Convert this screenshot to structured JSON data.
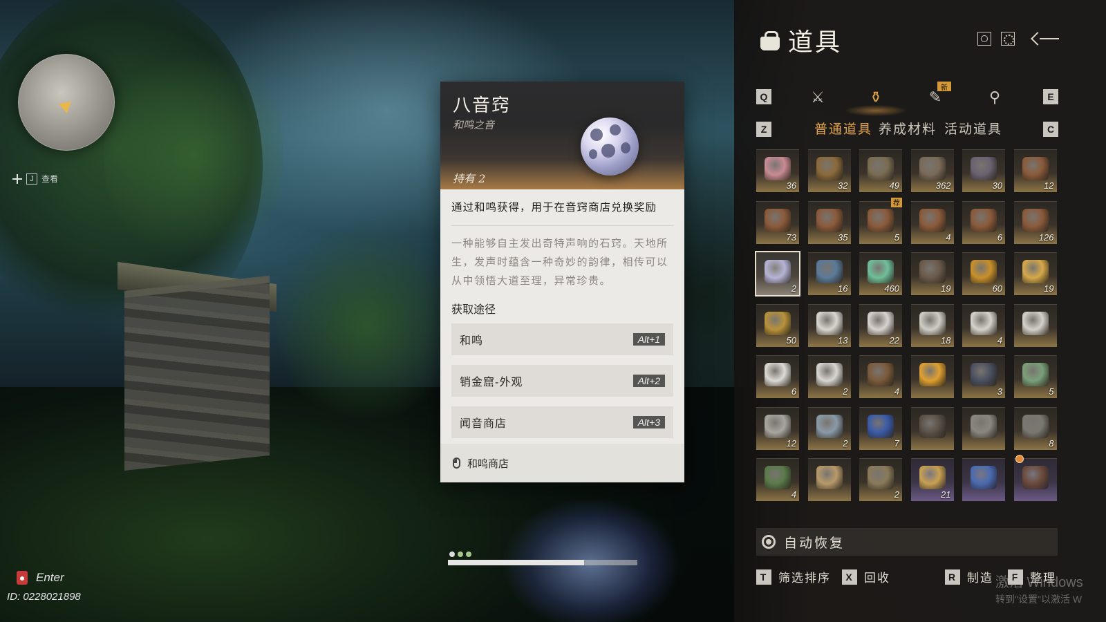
{
  "hud": {
    "map_hint_key": "J",
    "map_hint_label": "查看",
    "enter_label": "Enter",
    "uid": "ID: 0228021898"
  },
  "tooltip": {
    "title": "八音窍",
    "subtitle": "和鸣之音",
    "owned": "持有 2",
    "summary": "通过和鸣获得，用于在音窍商店兑换奖励",
    "description": "一种能够自主发出奇特声响的石窍。天地所生，发声时蕴含一种奇妙的韵律，相传可以从中领悟大道至理，异常珍贵。",
    "source_header": "获取途径",
    "sources": [
      {
        "label": "和鸣",
        "key": "Alt+1"
      },
      {
        "label": "销金窟-外观",
        "key": "Alt+2"
      },
      {
        "label": "闻音商店",
        "key": "Alt+3"
      }
    ],
    "footer_label": "和鸣商店"
  },
  "pager": {
    "page_count": 3,
    "active_page": 3,
    "progress": 0.72
  },
  "panel": {
    "title": "道具",
    "category_left_key": "Q",
    "category_right_key": "E",
    "categories": [
      {
        "icon": "weapon-icon",
        "glyph": "⚔",
        "badge": ""
      },
      {
        "icon": "pouch-icon",
        "glyph": "⚱",
        "badge": "",
        "active": true
      },
      {
        "icon": "tool-icon",
        "glyph": "✎",
        "badge": "新"
      },
      {
        "icon": "location-icon",
        "glyph": "⚲",
        "badge": ""
      }
    ],
    "subtab_left_key": "Z",
    "subtab_right_key": "C",
    "subtabs": [
      {
        "label": "普通道具",
        "active": true
      },
      {
        "label": "养成材料",
        "active": false
      },
      {
        "label": "活动道具",
        "active": false
      }
    ],
    "items": [
      {
        "qty": "36",
        "color": "#c98b94"
      },
      {
        "qty": "32",
        "color": "#8a6a3a"
      },
      {
        "qty": "49",
        "color": "#7a6c52"
      },
      {
        "qty": "362",
        "color": "#7a6a58"
      },
      {
        "qty": "30",
        "color": "#6a6270"
      },
      {
        "qty": "12",
        "color": "#8a5a3a"
      },
      {
        "qty": "73",
        "color": "#8a5a3a"
      },
      {
        "qty": "35",
        "color": "#8a5a3a"
      },
      {
        "qty": "5",
        "color": "#8a5a3a",
        "tag": "荐"
      },
      {
        "qty": "4",
        "color": "#8a5a3a"
      },
      {
        "qty": "6",
        "color": "#8a5a3a"
      },
      {
        "qty": "126",
        "color": "#8a5a3a"
      },
      {
        "qty": "2",
        "color": "#b6b4d6",
        "selected": true
      },
      {
        "qty": "16",
        "color": "#5a7a9a"
      },
      {
        "qty": "460",
        "color": "#6fbf9a"
      },
      {
        "qty": "19",
        "color": "#6a5a4a"
      },
      {
        "qty": "60",
        "color": "#c9902a"
      },
      {
        "qty": "19",
        "color": "#d6a94a"
      },
      {
        "qty": "50",
        "color": "#b8923a"
      },
      {
        "qty": "13",
        "color": "#d8d6d0"
      },
      {
        "qty": "22",
        "color": "#d8d2d0"
      },
      {
        "qty": "18",
        "color": "#d0ccc6"
      },
      {
        "qty": "4",
        "color": "#d6d2cc"
      },
      {
        "qty": "",
        "color": "#d4d0ca"
      },
      {
        "qty": "6",
        "color": "#dcdad4"
      },
      {
        "qty": "2",
        "color": "#d8d6d0"
      },
      {
        "qty": "4",
        "color": "#7a5a3a"
      },
      {
        "qty": "",
        "color": "#e0a030"
      },
      {
        "qty": "3",
        "color": "#4a5060"
      },
      {
        "qty": "5",
        "color": "#7aa07a"
      },
      {
        "qty": "12",
        "color": "#a8a6a0"
      },
      {
        "qty": "2",
        "color": "#8a9aa8"
      },
      {
        "qty": "7",
        "color": "#3a5aa8"
      },
      {
        "qty": "",
        "color": "#5a5048"
      },
      {
        "qty": "",
        "color": "#8a8680"
      },
      {
        "qty": "8",
        "color": "#7a7670"
      },
      {
        "qty": "4",
        "color": "#5a7a4a"
      },
      {
        "qty": "",
        "color": "#b89a6a"
      },
      {
        "qty": "2",
        "color": "#8a7a5a"
      },
      {
        "qty": "21",
        "color": "#c8a050",
        "purple": true
      },
      {
        "qty": "",
        "color": "#4a6ab0",
        "purple": true
      },
      {
        "qty": "",
        "color": "#6a4a3a",
        "purple": true,
        "dot": true
      }
    ],
    "auto_restore_label": "自动恢复",
    "footer": [
      {
        "key": "T",
        "label": "筛选排序"
      },
      {
        "key": "X",
        "label": "回收"
      },
      {
        "key": "R",
        "label": "制造"
      },
      {
        "key": "F",
        "label": "整理"
      }
    ]
  },
  "watermark": {
    "line1": "激活 Windows",
    "line2": "转到\"设置\"以激活 W"
  }
}
